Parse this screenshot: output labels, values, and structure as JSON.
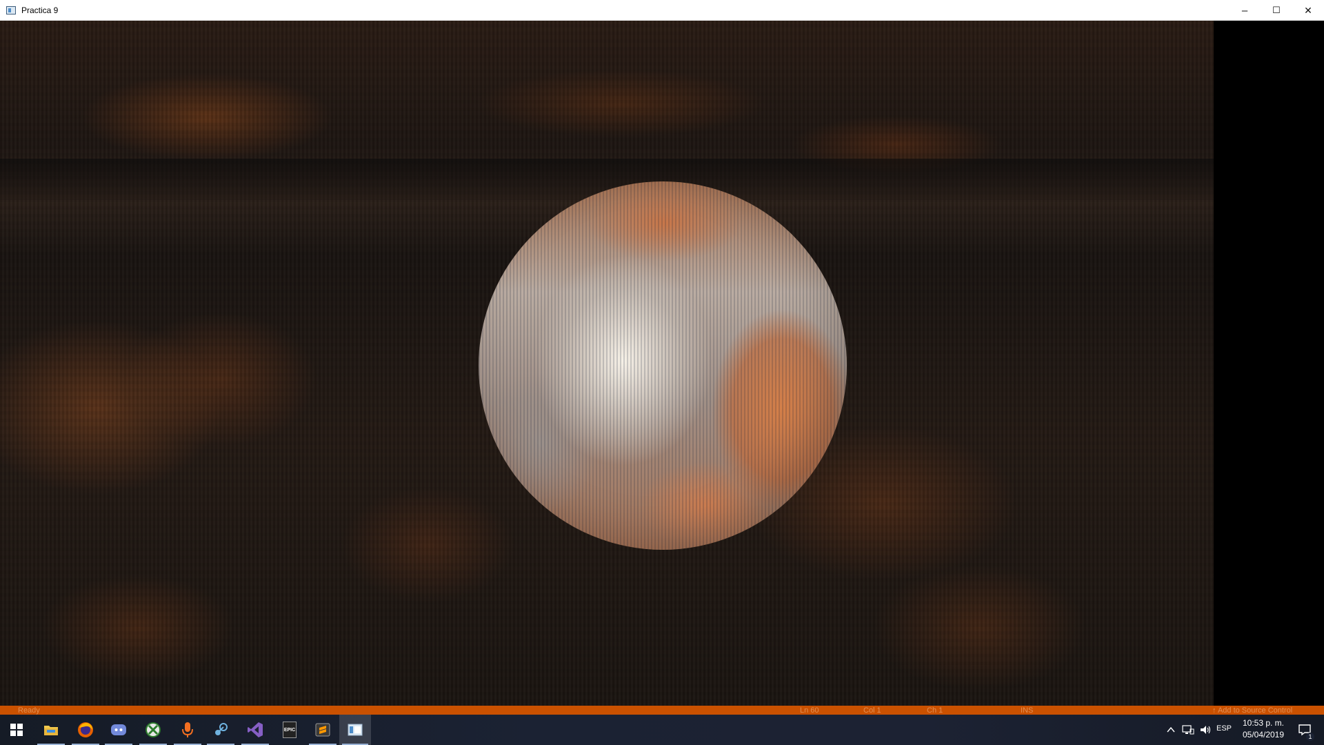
{
  "window": {
    "title": "Practica 9",
    "controls": {
      "minimize": "–",
      "maximize": "☐",
      "close": "✕"
    }
  },
  "statusbar": {
    "left": "Ready",
    "ln": "Ln 60",
    "col": "Col 1",
    "ch": "Ch 1",
    "ins": "INS",
    "source_control": "↑ Add to Source Control"
  },
  "taskbar": {
    "apps": [
      {
        "name": "start",
        "icon": "windows-logo-icon"
      },
      {
        "name": "file-explorer",
        "icon": "folder-icon"
      },
      {
        "name": "firefox",
        "icon": "firefox-icon"
      },
      {
        "name": "discord",
        "icon": "discord-icon"
      },
      {
        "name": "xbox",
        "icon": "xbox-icon"
      },
      {
        "name": "podcast",
        "icon": "microphone-icon"
      },
      {
        "name": "steam",
        "icon": "steam-icon"
      },
      {
        "name": "visual-studio",
        "icon": "visual-studio-icon"
      },
      {
        "name": "epic-games",
        "icon": "epic-games-icon",
        "label": "EPIC"
      },
      {
        "name": "sublime",
        "icon": "sublime-icon"
      },
      {
        "name": "practica-9",
        "icon": "opengl-window-icon"
      }
    ],
    "tray": {
      "language": "ESP",
      "time": "10:53 p. m.",
      "date": "05/04/2019",
      "notification_count": "1"
    }
  },
  "colors": {
    "vs_status": "#ca5100",
    "taskbar": "#1b2233",
    "titlebar": "#ffffff"
  }
}
